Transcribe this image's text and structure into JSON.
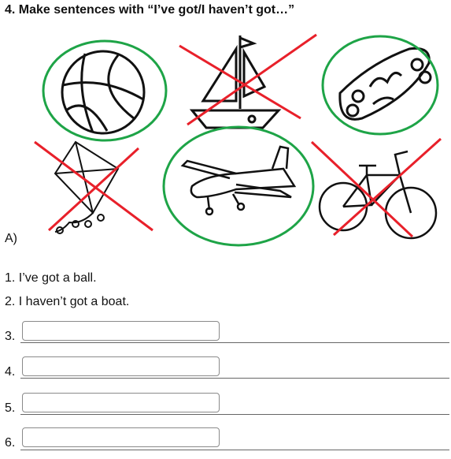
{
  "title": "4. Make sentences with “I’ve got/I haven’t got…”",
  "colors": {
    "got_circle": "#1ea447",
    "not_got_cross": "#e8202a",
    "ink": "#111111"
  },
  "pictures": [
    {
      "name": "ball",
      "icon": "basketball-icon",
      "mark": "circle"
    },
    {
      "name": "boat",
      "icon": "sailboat-icon",
      "mark": "cross"
    },
    {
      "name": "skateboard",
      "icon": "skateboard-icon",
      "mark": "circle"
    },
    {
      "name": "kite",
      "icon": "kite-icon",
      "mark": "cross"
    },
    {
      "name": "plane",
      "icon": "airplane-icon",
      "mark": "circle"
    },
    {
      "name": "bike",
      "icon": "bicycle-icon",
      "mark": "cross"
    }
  ],
  "section_label": "A)",
  "examples": [
    "1. I’ve got a ball.",
    "2. I haven’t got a boat."
  ],
  "answers": [
    {
      "number": "3.",
      "value": ""
    },
    {
      "number": "4.",
      "value": ""
    },
    {
      "number": "5.",
      "value": ""
    },
    {
      "number": "6.",
      "value": ""
    }
  ]
}
